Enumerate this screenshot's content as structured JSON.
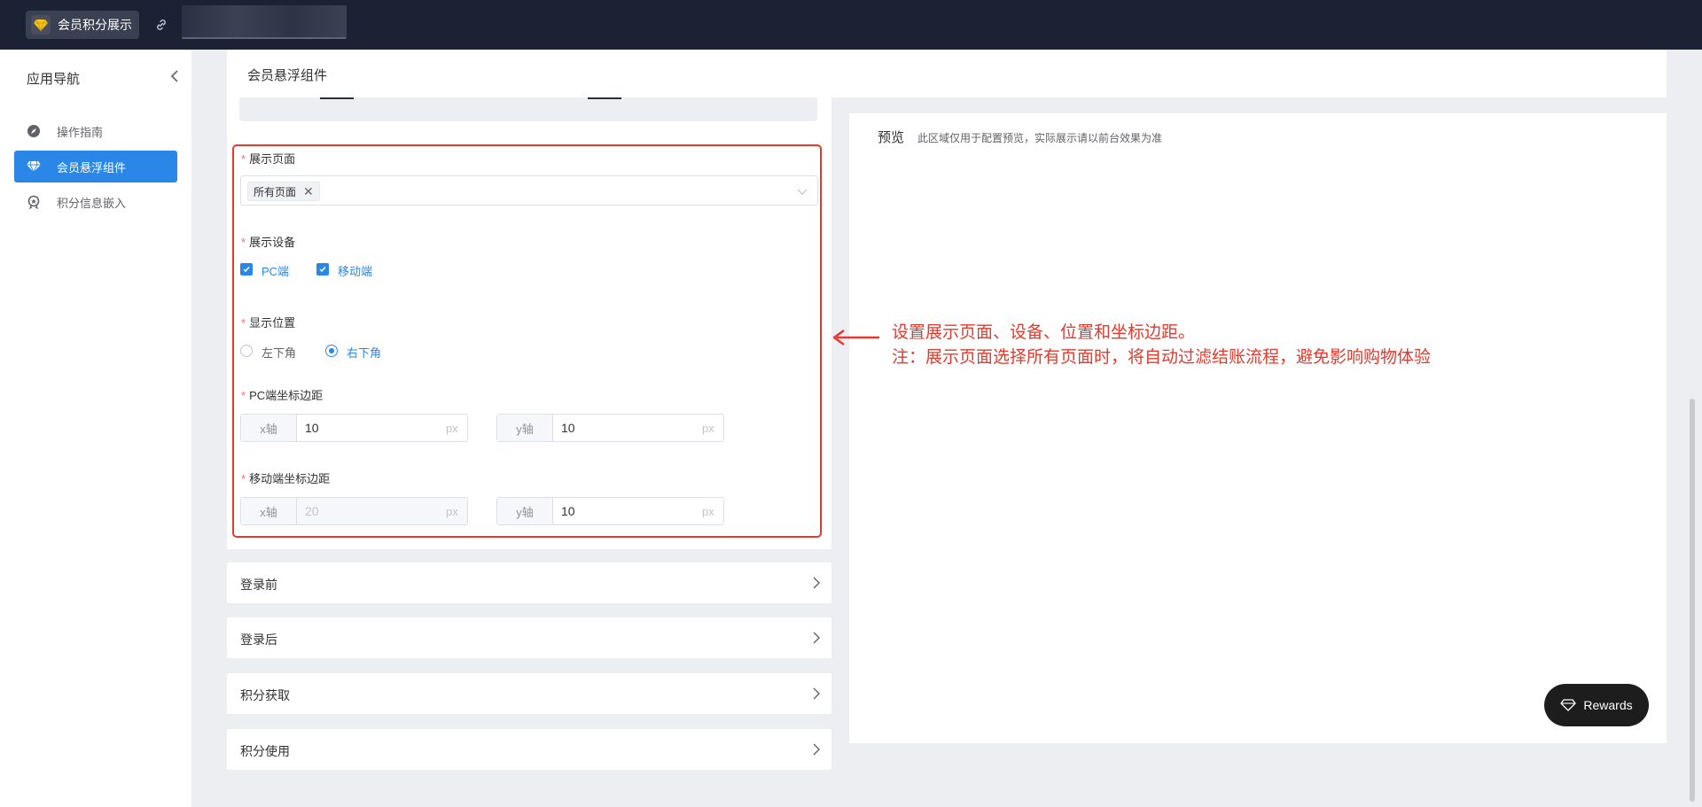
{
  "topbar": {
    "app_name": "会员积分展示",
    "logo_icon": "diamond-logo-icon",
    "link_icon": "link-icon"
  },
  "sidebar": {
    "title": "应用导航",
    "items": [
      {
        "label": "操作指南",
        "icon": "compass-icon",
        "active": false
      },
      {
        "label": "会员悬浮组件",
        "icon": "diamond-icon",
        "active": true
      },
      {
        "label": "积分信息嵌入",
        "icon": "badge-icon",
        "active": false
      }
    ]
  },
  "header": {
    "title": "会员悬浮组件"
  },
  "form": {
    "display_pages": {
      "label": "展示页面",
      "selected_tag": "所有页面"
    },
    "display_devices": {
      "label": "展示设备",
      "options": [
        "PC端",
        "移动端"
      ],
      "checked": [
        true,
        true
      ]
    },
    "position": {
      "label": "显示位置",
      "options": [
        "左下角",
        "右下角"
      ],
      "selected": "右下角"
    },
    "pc_margin": {
      "label": "PC端坐标边距",
      "x_prefix": "x轴",
      "x_value": "10",
      "y_prefix": "y轴",
      "y_value": "10",
      "unit": "px"
    },
    "mobile_margin": {
      "label": "移动端坐标边距",
      "x_prefix": "x轴",
      "x_value": "20",
      "x_disabled": true,
      "y_prefix": "y轴",
      "y_value": "10",
      "unit": "px"
    }
  },
  "sections": [
    "登录前",
    "登录后",
    "积分获取",
    "积分使用"
  ],
  "preview": {
    "title": "预览",
    "desc": "此区域仅用于配置预览，实际展示请以前台效果为准",
    "rewards_label": "Rewards"
  },
  "annotation": {
    "line1": "设置展示页面、设备、位置和坐标边距。",
    "line2": "注：展示页面选择所有页面时，将自动过滤结账流程，避免影响购物体验"
  },
  "colors": {
    "accent": "#2b87e7",
    "annotation": "#e03b2e",
    "topbar": "#1b2233"
  }
}
